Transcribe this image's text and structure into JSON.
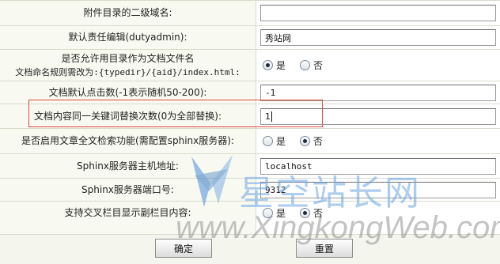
{
  "rows": [
    {
      "label": "附件目录的二级域名:",
      "value": ""
    },
    {
      "label": "默认责任编辑(dutyadmin):",
      "value": "秀站网"
    },
    {
      "label_line1": "是否允许用目录作为文档文件名",
      "label_line2": "文档命名规则需改为:{typedir}/{aid}/index.html:",
      "opt_yes": "是",
      "opt_no": "否",
      "selected": "是"
    },
    {
      "label": "文档默认点击数(-1表示随机50-200):",
      "value": "-1"
    },
    {
      "label": "文档内容同一关键词替换次数(0为全部替换):",
      "value": "1"
    },
    {
      "label": "是否启用文章全文检索功能(需配置sphinx服务器):",
      "opt_yes": "是",
      "opt_no": "否",
      "selected": "否"
    },
    {
      "label": "Sphinx服务器主机地址:",
      "value": "localhost"
    },
    {
      "label": "Sphinx服务器端口号:",
      "value": "9312"
    },
    {
      "label": "支持交叉栏目显示副栏目内容:",
      "opt_yes": "是",
      "opt_no": "否",
      "selected": "否"
    }
  ],
  "buttons": {
    "confirm": "确定",
    "reset": "重置"
  },
  "watermark": {
    "cn": "星空站长网",
    "en": "www.XingkongWeb.com"
  },
  "colors": {
    "label_bg": "#f8f9f1",
    "border": "#d6dccb",
    "highlight": "#e0483a"
  }
}
